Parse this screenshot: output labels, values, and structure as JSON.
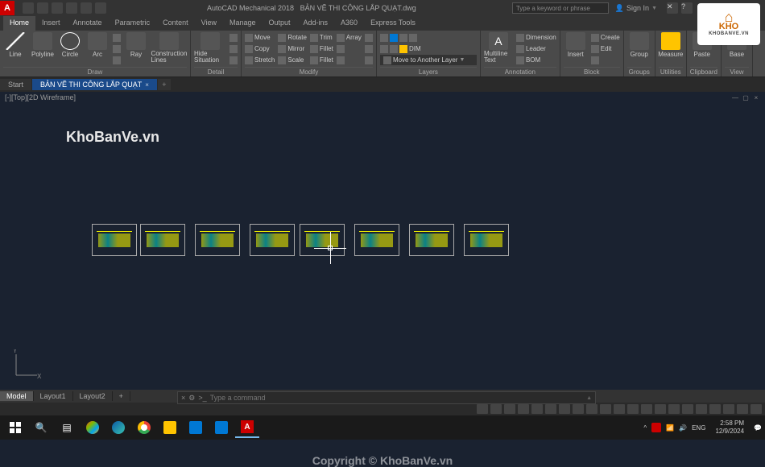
{
  "titlebar": {
    "app": "AutoCAD Mechanical 2018",
    "document": "BẢN VẼ THI CÔNG LẮP QUẠT.dwg",
    "search_placeholder": "Type a keyword or phrase",
    "signin": "Sign In"
  },
  "ribbon_tabs": [
    "Home",
    "Insert",
    "Annotate",
    "Parametric",
    "Content",
    "View",
    "Manage",
    "Output",
    "Add-ins",
    "A360",
    "Express Tools"
  ],
  "ribbon": {
    "draw": {
      "label": "Draw",
      "items": [
        "Line",
        "Polyline",
        "Circle",
        "Arc"
      ],
      "extras": [
        "Ray",
        "Construction Lines"
      ]
    },
    "detail": {
      "label": "Detail",
      "items": [
        "Hide Situation"
      ]
    },
    "modify": {
      "label": "Modify",
      "rows": [
        [
          "Move",
          "Rotate",
          "Trim",
          "Array"
        ],
        [
          "Copy",
          "Mirror",
          "Fillet",
          ""
        ],
        [
          "Stretch",
          "Scale",
          "Fillet",
          ""
        ]
      ]
    },
    "layers": {
      "label": "Layers",
      "combo": "Move to Another Layer",
      "dim": "DIM"
    },
    "annotation": {
      "label": "Annotation",
      "items": [
        "Multiline Text",
        "Dimension",
        "Leader",
        "BOM"
      ]
    },
    "insert": {
      "label": "Insert",
      "btn": "Insert",
      "items": [
        "Create",
        "Edit"
      ]
    },
    "block": {
      "label": "Block"
    },
    "groups": {
      "label": "Groups",
      "btn": "Group"
    },
    "utilities": {
      "label": "Utilities",
      "btn": "Measure"
    },
    "clipboard": {
      "label": "Clipboard",
      "btn": "Paste"
    },
    "view": {
      "label": "View",
      "btn": "Base"
    }
  },
  "file_tabs": {
    "start": "Start",
    "active": "BẢN VẼ THI CÔNG LẮP QUẠT"
  },
  "viewport": {
    "label": "[-][Top][2D Wireframe]"
  },
  "canvas": {
    "watermark": "KhoBanVe.vn",
    "copyright": "Copyright © KhoBanVe.vn",
    "ucs": {
      "x": "X",
      "y": "Y"
    }
  },
  "logo_overlay": {
    "line1": "KHO",
    "line2": "KHOBANVE.VN"
  },
  "bottom_tabs": [
    "Model",
    "Layout1",
    "Layout2"
  ],
  "cmdline": {
    "prompt": ">_",
    "placeholder": "Type a command"
  },
  "taskbar": {
    "time": "2:58 PM",
    "date": "12/9/2024"
  }
}
